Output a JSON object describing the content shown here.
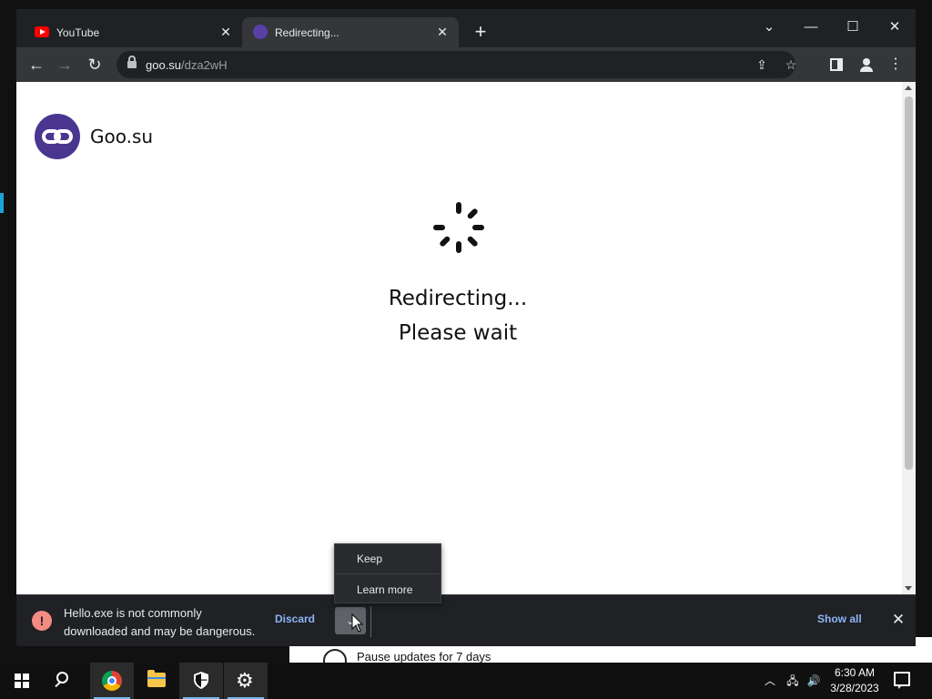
{
  "browser": {
    "tabs": [
      {
        "title": "YouTube",
        "favicon": "youtube-icon",
        "active": false
      },
      {
        "title": "Redirecting...",
        "favicon": "goo-su-favicon",
        "active": true
      }
    ],
    "address": {
      "host": "goo.su",
      "path": "/dza2wH"
    },
    "toolbar_icons": [
      "back-arrow-icon",
      "forward-arrow-icon",
      "reload-icon",
      "lock-icon",
      "share-icon",
      "star-icon",
      "side-panel-icon",
      "profile-icon",
      "kebab-menu-icon"
    ]
  },
  "page": {
    "brand": "Goo.su",
    "line1": "Redirecting...",
    "line2": "Please wait"
  },
  "download_bar": {
    "message_line1": "Hello.exe is not commonly",
    "message_line2": "downloaded and may be dangerous.",
    "discard_label": "Discard",
    "show_all_label": "Show all",
    "menu": [
      {
        "label": "Keep"
      },
      {
        "label": "Learn more"
      }
    ]
  },
  "background_window": {
    "text": "Pause updates for 7 days"
  },
  "taskbar": {
    "time": "6:30 AM",
    "date": "3/28/2023"
  },
  "colors": {
    "brand_purple": "#4a3591",
    "link_blue": "#8ab4f8",
    "warning_red": "#f28b82",
    "chrome_dark": "#202124",
    "chrome_toolbar": "#35363a"
  }
}
